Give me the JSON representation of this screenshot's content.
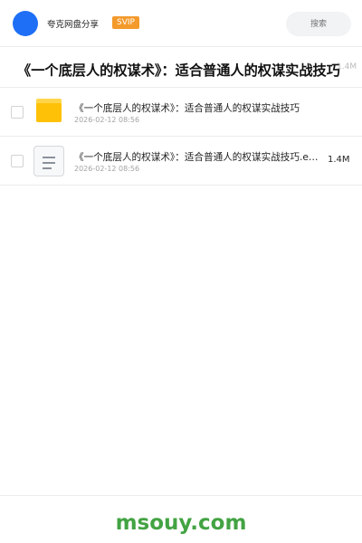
{
  "header": {
    "app_title": "夸克网盘分享",
    "badge": "SVIP",
    "search_placeholder": "搜索"
  },
  "share": {
    "title": "《一个底层人的权谋术》：适合普通人的权谋实战技巧",
    "total_size": "1.4M"
  },
  "items": [
    {
      "type": "folder",
      "icon": "folder-icon",
      "name": "《一个底层人的权谋术》：适合普通人的权谋实战技巧",
      "date": "2026-02-12 08:56",
      "size": ""
    },
    {
      "type": "document",
      "icon": "document-icon",
      "name": "《一个底层人的权谋术》：适合普通人的权谋实战技巧.epub",
      "date": "2026-02-12 08:56",
      "size": "1.4M"
    }
  ],
  "footer": {
    "watermark": "msouy.com"
  },
  "colors": {
    "avatar": "#1e6ff5",
    "badge": "#f39a2b",
    "folder": "#ffc107",
    "watermark": "#43a343"
  }
}
